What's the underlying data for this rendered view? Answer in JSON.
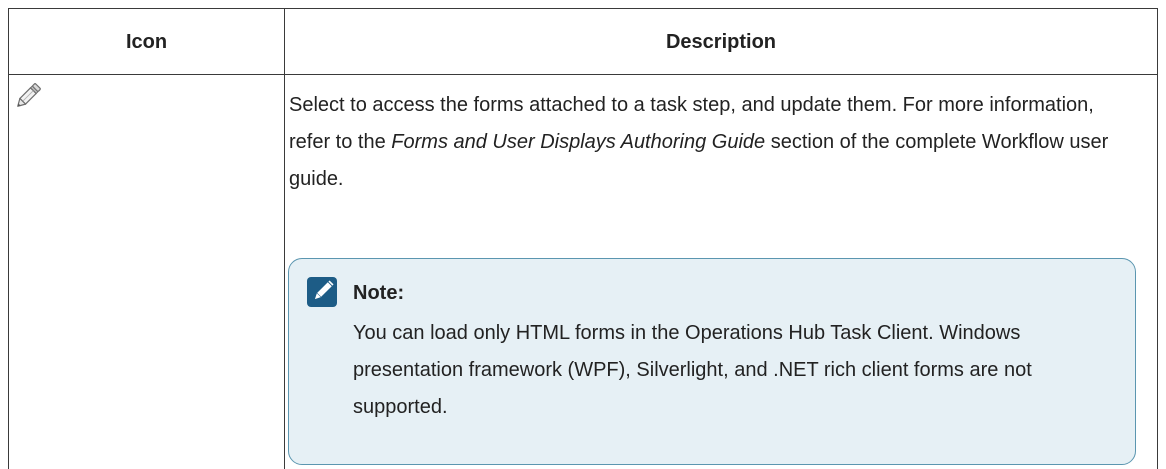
{
  "table": {
    "headers": {
      "icon": "Icon",
      "description": "Description"
    },
    "row": {
      "icon_name": "pencil-icon",
      "description_before": "Select to access the forms attached to a task step, and update them. For more information, refer to the ",
      "description_link_title": "Forms and User Displays Authoring Guide",
      "description_after": " section of the complete Workflow user guide.",
      "note": {
        "icon_name": "edit-note-icon",
        "title": "Note:",
        "body": "You can load only HTML forms in the Operations Hub Task Client. Windows presentation framework (WPF), Silverlight, and .NET rich client forms are not supported."
      }
    }
  },
  "colors": {
    "note_background": "#e6f0f5",
    "note_border": "#5b96b0",
    "note_icon": "#1d5c86",
    "table_border": "#3a3a3a"
  }
}
